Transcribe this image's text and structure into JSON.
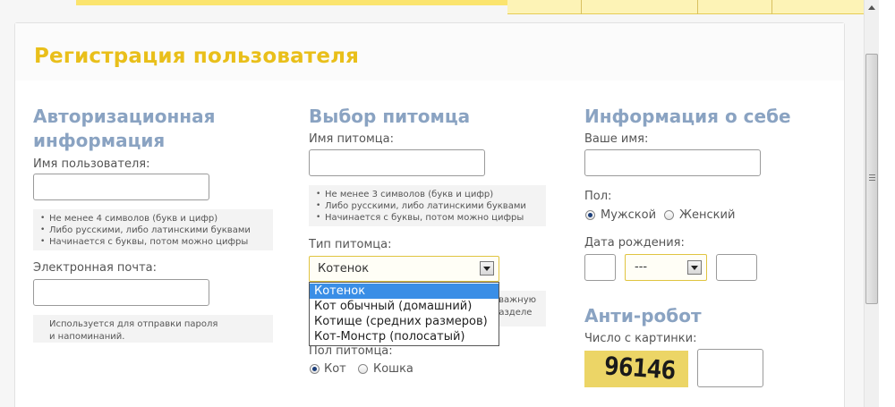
{
  "page_title": "Регистрация пользователя",
  "auth": {
    "title": "Авторизационная информация",
    "username_label": "Имя пользователя:",
    "username_hints": [
      "Не менее 4 символов (букв и цифр)",
      "Либо русскими, либо латинскими буквами",
      "Начинается с буквы, потом можно цифры"
    ],
    "email_label": "Электронная почта:",
    "email_hint": "Используется для отправки пароля\nи напоминаний."
  },
  "pet": {
    "title": "Выбор питомца",
    "name_label": "Имя питомца:",
    "name_hints": [
      "Не менее 3 символов (букв и цифр)",
      "Либо русскими, либо латинскими буквами",
      "Начинается с буквы, потом можно цифры"
    ],
    "type_label": "Тип питомца:",
    "type_selected": "Котенок",
    "type_options": [
      "Котенок",
      "Кот обычный (домашний)",
      "Котище (средних размеров)",
      "Кот-Монстр (полосатый)"
    ],
    "type_hint_partial_1": "ет важную",
    "type_hint_partial_2": "разделе",
    "gender_label": "Пол питомца:",
    "gender_options": [
      "Кот",
      "Кошка"
    ],
    "gender_selected": "Кот"
  },
  "about": {
    "title": "Информация о себе",
    "name_label": "Ваше имя:",
    "gender_label": "Пол:",
    "gender_options": [
      "Мужской",
      "Женский"
    ],
    "gender_selected": "Мужской",
    "birth_label": "Дата рождения:",
    "birth_month_value": "---"
  },
  "antirobot": {
    "title": "Анти-робот",
    "captcha_label": "Число с картинки:",
    "captcha_text": "96146"
  },
  "colors": {
    "accent_yellow": "#e9bf1a",
    "section_blue": "#8aa3c2",
    "selection_blue": "#3a8ee6"
  }
}
